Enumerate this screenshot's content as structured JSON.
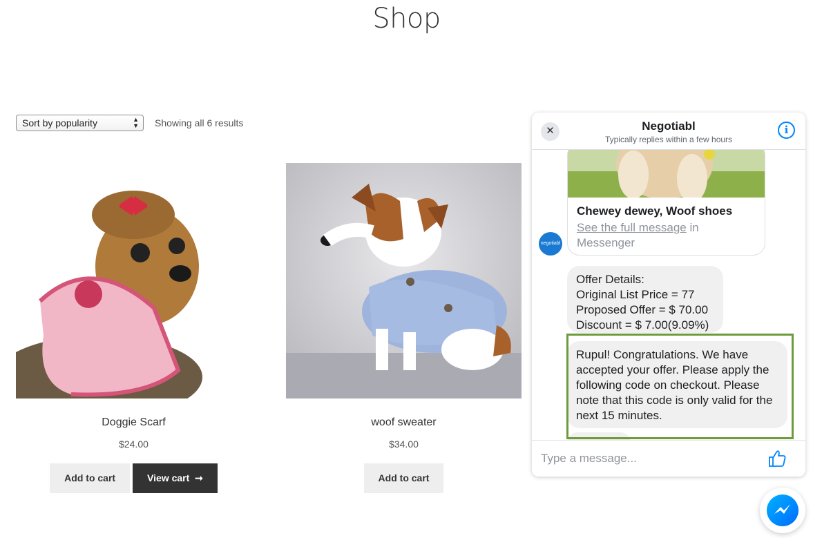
{
  "page": {
    "title": "Shop"
  },
  "toolbar": {
    "sort_selected": "Sort by popularity",
    "result_count": "Showing all 6 results"
  },
  "products": [
    {
      "title": "Doggie Scarf",
      "price": "$24.00",
      "add_label": "Add to cart",
      "view_cart_label": "View cart"
    },
    {
      "title": "woof sweater",
      "price": "$34.00",
      "add_label": "Add to cart"
    }
  ],
  "chat": {
    "name": "Negotiabl",
    "subtitle": "Typically replies within a few hours",
    "card": {
      "title": "Chewey dewey, Woof shoes",
      "link_text": "See the full message",
      "link_suffix": " in Messenger"
    },
    "avatar_text": "negotiabl",
    "offer_lines": [
      "Offer Details:",
      "Original List Price = 77",
      "Proposed Offer = $ 70.00",
      "Discount = $ 7.00(9.09%)"
    ],
    "congrats_text": "Rupul! Congratulations. We have accepted your offer. Please apply the following code on checkout. Please note that this code is only valid for the next 15 minutes.",
    "input_placeholder": "Type a message..."
  },
  "colors": {
    "messenger_blue": "#0084ff",
    "highlight_green": "#6b9b3a",
    "button_dark": "#333333",
    "button_light": "#eeeeee"
  },
  "icons": [
    "close-icon",
    "info-icon",
    "thumbs-up-icon",
    "messenger-icon",
    "arrow-right-icon"
  ]
}
